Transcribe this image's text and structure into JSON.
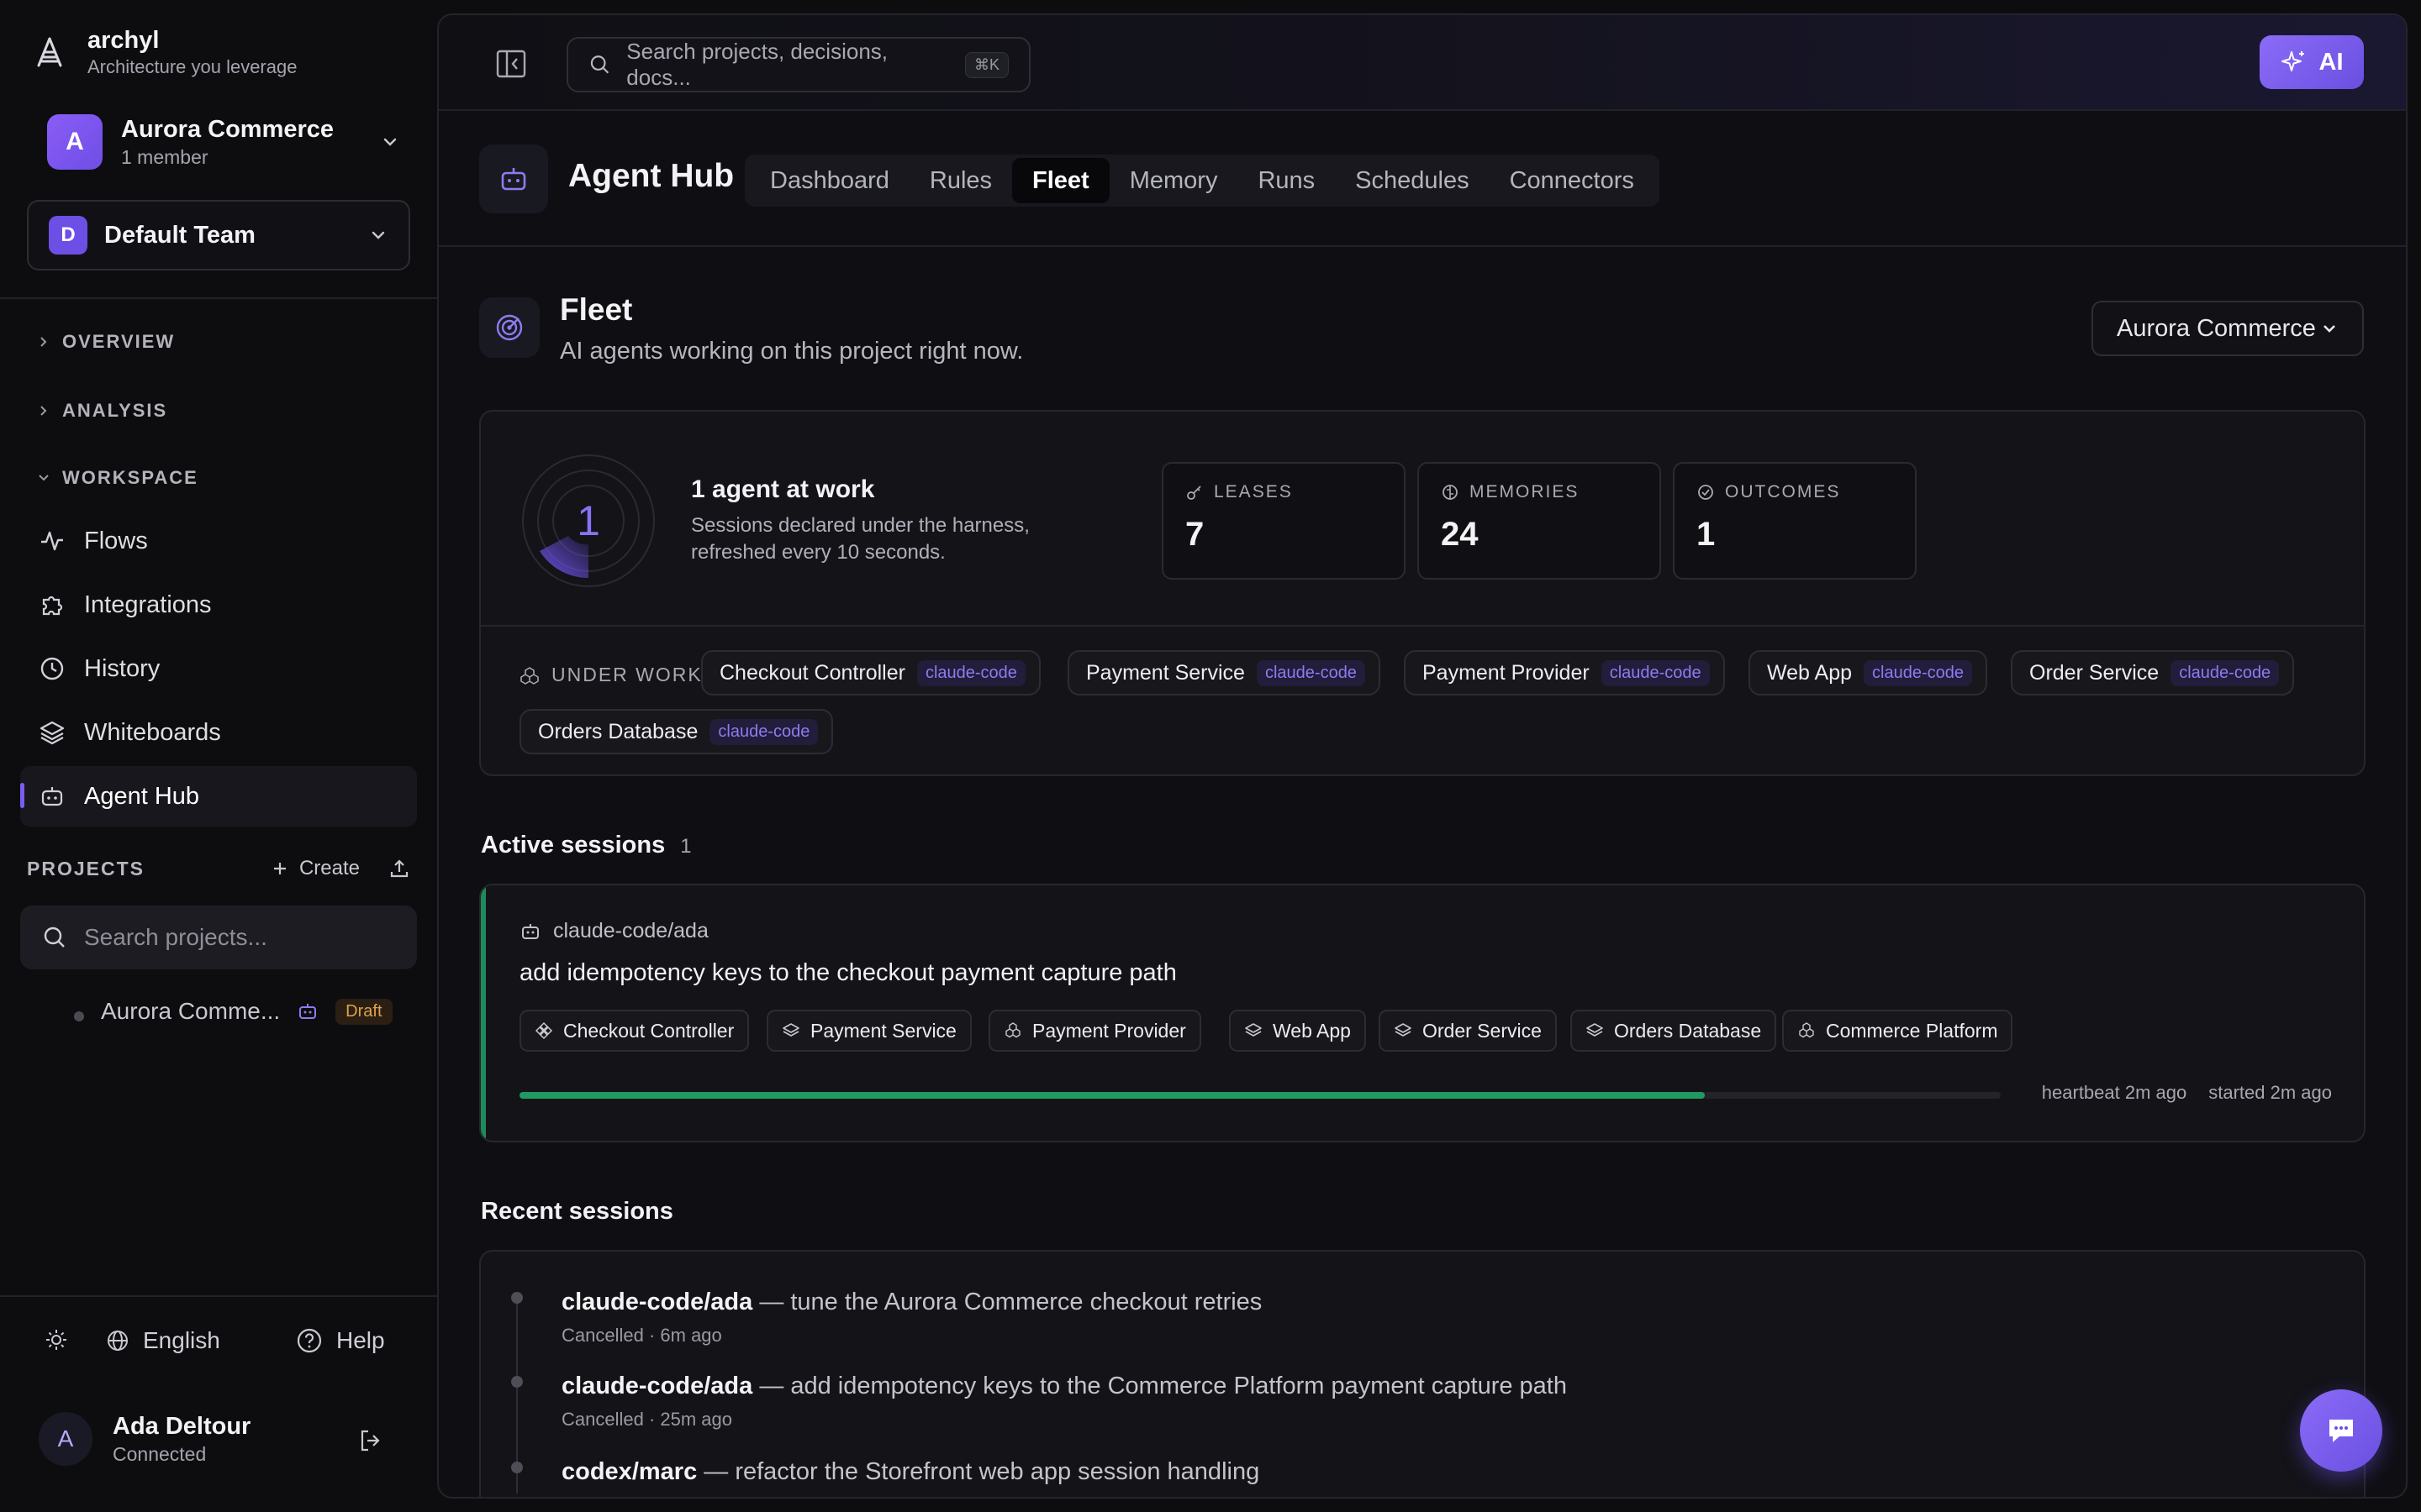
{
  "brand": {
    "name": "archyl",
    "tagline": "Architecture you leverage"
  },
  "org": {
    "initial": "A",
    "name": "Aurora Commerce",
    "members": "1 member"
  },
  "team": {
    "initial": "D",
    "name": "Default Team"
  },
  "sections": {
    "overview": "OVERVIEW",
    "analysis": "ANALYSIS",
    "workspace": "WORKSPACE"
  },
  "nav": {
    "flows": "Flows",
    "integrations": "Integrations",
    "history": "History",
    "whiteboards": "Whiteboards",
    "agent_hub": "Agent Hub"
  },
  "projects": {
    "heading": "PROJECTS",
    "create": "Create",
    "search_placeholder": "Search projects...",
    "item_name": "Aurora Comme...",
    "item_badge": "Draft"
  },
  "footer": {
    "language": "English",
    "help": "Help"
  },
  "user": {
    "initial": "A",
    "name": "Ada Deltour",
    "status": "Connected"
  },
  "topbar": {
    "search_placeholder": "Search projects, decisions, docs...",
    "shortcut": "⌘K",
    "ai_label": "AI"
  },
  "hub": {
    "title": "Agent Hub",
    "tabs": [
      "Dashboard",
      "Rules",
      "Fleet",
      "Memory",
      "Runs",
      "Schedules",
      "Connectors"
    ],
    "active_tab": "Fleet"
  },
  "fleet": {
    "title": "Fleet",
    "subtitle": "AI agents working on this project right now.",
    "project_select": "Aurora Commerce",
    "agents_count": "1",
    "work_title": "1 agent at work",
    "work_subtitle": "Sessions declared under the harness, refreshed every 10 seconds.",
    "stats": [
      {
        "label": "LEASES",
        "value": "7",
        "icon": "key-icon"
      },
      {
        "label": "MEMORIES",
        "value": "24",
        "icon": "brain-icon"
      },
      {
        "label": "OUTCOMES",
        "value": "1",
        "icon": "check-circle-icon"
      }
    ],
    "under_work_label": "UNDER WORK",
    "under_work": [
      {
        "name": "Checkout Controller",
        "tag": "claude-code"
      },
      {
        "name": "Payment Service",
        "tag": "claude-code"
      },
      {
        "name": "Payment Provider",
        "tag": "claude-code"
      },
      {
        "name": "Web App",
        "tag": "claude-code"
      },
      {
        "name": "Order Service",
        "tag": "claude-code"
      },
      {
        "name": "Orders Database",
        "tag": "claude-code"
      }
    ]
  },
  "active_sessions": {
    "heading": "Active sessions",
    "count": "1",
    "session": {
      "agent": "claude-code/ada",
      "title": "add idempotency keys to the checkout payment capture path",
      "components": [
        "Checkout Controller",
        "Payment Service",
        "Payment Provider",
        "Web App",
        "Order Service",
        "Orders Database",
        "Commerce Platform"
      ],
      "progress": 0.8,
      "heartbeat": "heartbeat 2m ago",
      "started": "started 2m ago"
    }
  },
  "recent_sessions": {
    "heading": "Recent sessions",
    "items": [
      {
        "agent": "claude-code/ada",
        "task": "— tune the Aurora Commerce checkout retries",
        "status": "Cancelled · 6m ago"
      },
      {
        "agent": "claude-code/ada",
        "task": "— add idempotency keys to the Commerce Platform payment capture path",
        "status": "Cancelled · 25m ago"
      },
      {
        "agent": "codex/marc",
        "task": "— refactor the Storefront web app session handling",
        "status": ""
      }
    ]
  },
  "colors": {
    "accent": "#7c5cf0",
    "success": "#1f9a63",
    "warning": "#e0a050"
  }
}
